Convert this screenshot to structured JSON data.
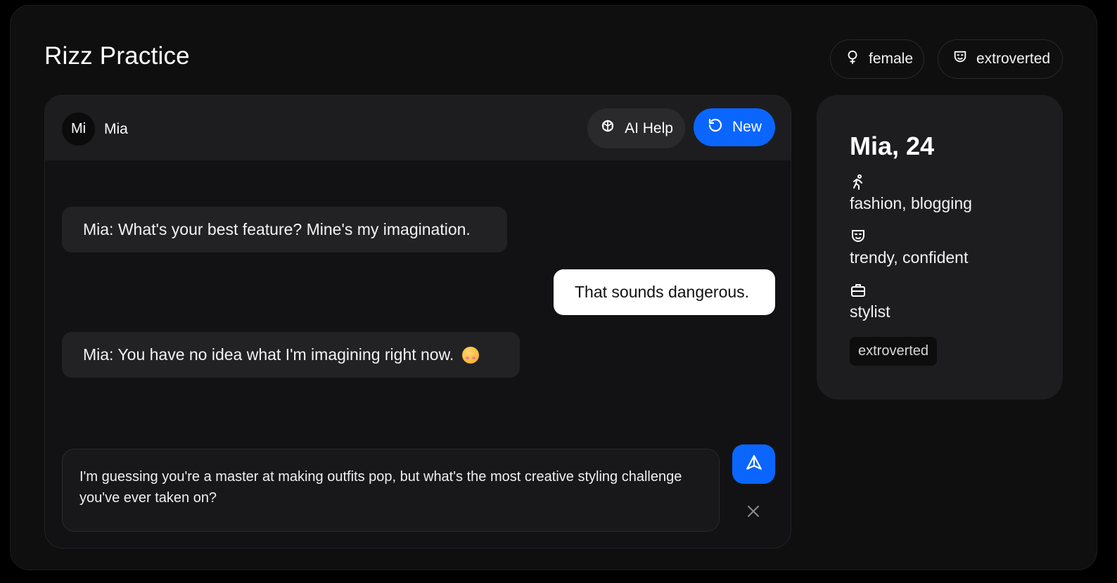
{
  "app": {
    "title": "Rizz Practice"
  },
  "header_tags": [
    {
      "icon": "female-icon",
      "label": "female"
    },
    {
      "icon": "mask-icon",
      "label": "extroverted"
    }
  ],
  "chat": {
    "avatar_initials": "Mi",
    "contact_name": "Mia",
    "ai_help_label": "AI Help",
    "new_label": "New",
    "messages": [
      {
        "sender": "bot",
        "text": "Mia: What's your best feature? Mine's my imagination."
      },
      {
        "sender": "user",
        "text": "That sounds dangerous."
      },
      {
        "sender": "bot",
        "text": "Mia: You have no idea what I'm imagining right now.",
        "emoji": "drooling-face-emoji"
      }
    ],
    "input_value": "I'm guessing you're a master at making outfits pop, but what's the most creative styling challenge you've ever taken on?"
  },
  "profile": {
    "name_age": "Mia, 24",
    "interests_icon": "running-person-icon",
    "interests": "fashion, blogging",
    "traits_icon": "mask-icon",
    "traits": "trendy, confident",
    "job_icon": "briefcase-icon",
    "job": "stylist",
    "badge": "extroverted"
  },
  "colors": {
    "accent": "#0a66ff",
    "background": "#0f0f10",
    "card": "#1d1d20",
    "user_bubble": "#ffffff",
    "bot_bubble": "#222225"
  }
}
